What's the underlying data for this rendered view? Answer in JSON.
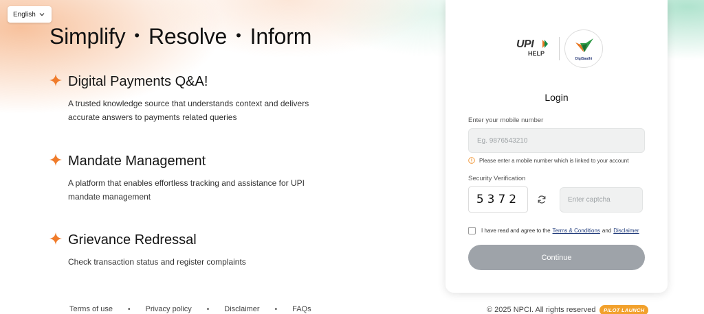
{
  "language": {
    "selected": "English"
  },
  "hero": {
    "words": [
      "Simplify",
      "Resolve",
      "Inform"
    ],
    "separator": "•"
  },
  "features": [
    {
      "title": "Digital Payments Q&A!",
      "description": "A trusted knowledge source that understands context and delivers accurate answers to payments related queries"
    },
    {
      "title": "Mandate Management",
      "description": "A platform that enables effortless tracking and assistance for UPI mandate management"
    },
    {
      "title": "Grievance Redressal",
      "description": "Check transaction status and register complaints"
    }
  ],
  "footer": {
    "links": [
      "Terms of use",
      "Privacy policy",
      "Disclaimer",
      "FAQs"
    ],
    "separator": "•",
    "copyright": "© 2025 NPCI. All rights reserved",
    "badge": "PILOT LAUNCH"
  },
  "login": {
    "logos": {
      "upi": "UPI",
      "upi_sub": "HELP",
      "digisaathi": "DigiSaathi"
    },
    "title": "Login",
    "mobile_label": "Enter your mobile number",
    "mobile_placeholder": "Eg. 9876543210",
    "mobile_hint": "Please enter a mobile number which is linked to your account",
    "security_label": "Security Verification",
    "captcha_code": "5372",
    "captcha_placeholder": "Enter captcha",
    "agree_prefix": "I have read and agree to the",
    "terms_link": "Terms & Conditions",
    "agree_and": "and",
    "disclaimer_link": "Disclaimer",
    "continue_label": "Continue"
  },
  "colors": {
    "accent_orange": "#f07b2a",
    "button_disabled": "#9ea3a9",
    "badge": "#f2a12c",
    "link": "#1f3a7a"
  },
  "icons": [
    "chevron-down-icon",
    "sparkle-icon",
    "info-icon",
    "refresh-icon"
  ]
}
